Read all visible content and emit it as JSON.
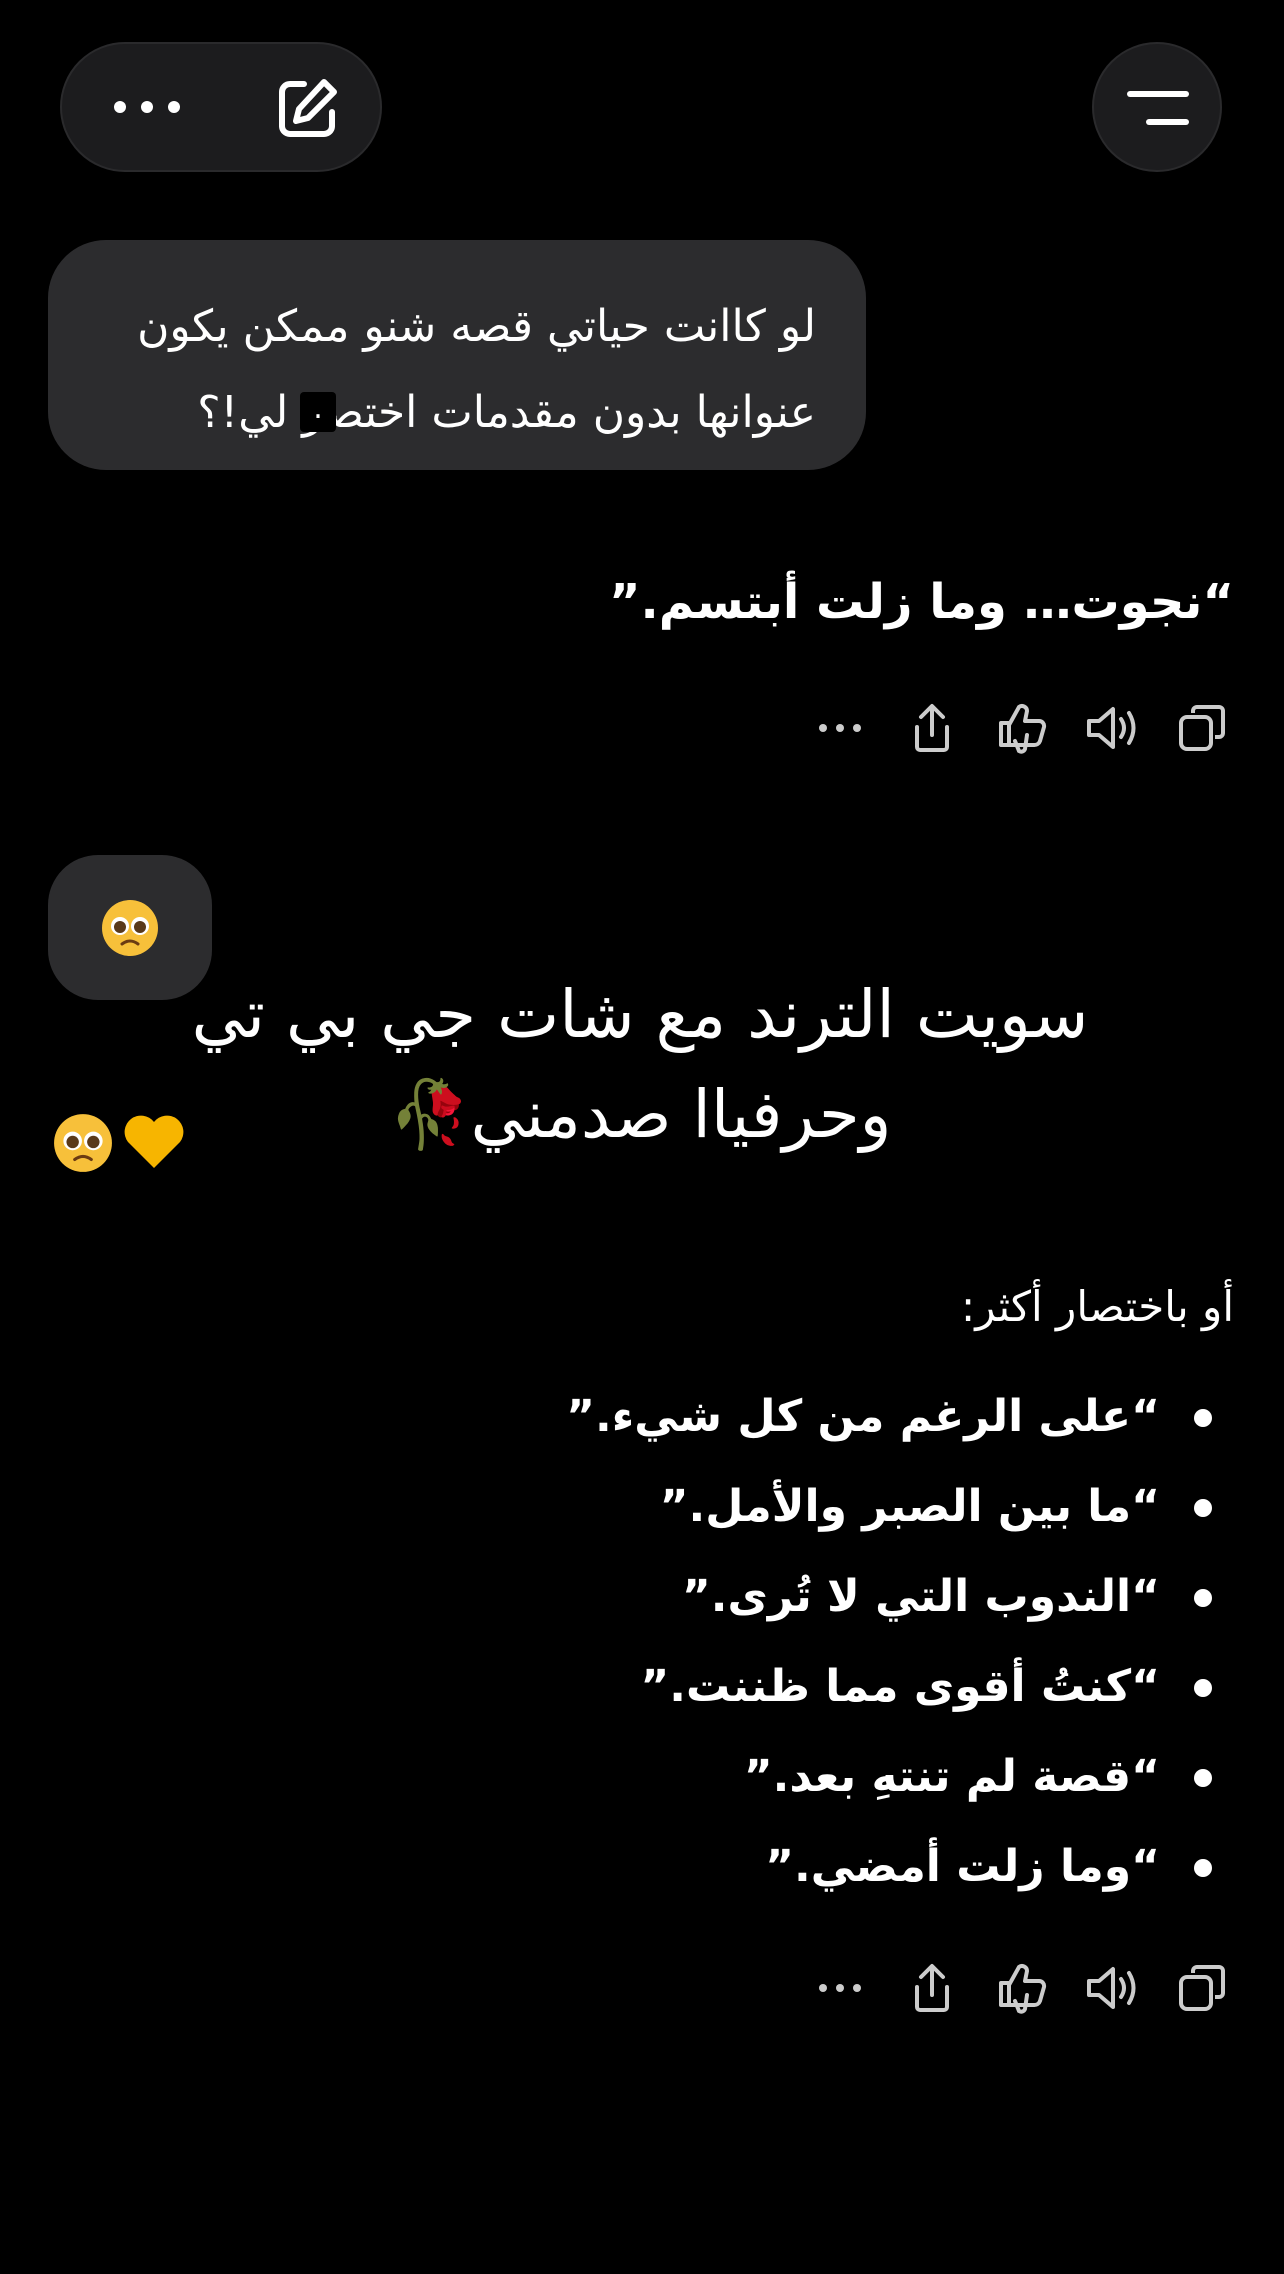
{
  "top_bar": {
    "more_icon": "more-horizontal-icon",
    "compose_icon": "compose-edit-icon",
    "menu_icon": "menu-lines-icon"
  },
  "user_message": {
    "line1": "لو كاانت حياتي قصه شنو ممكن يكون",
    "line2": "عنوانها بدون مقدمات اختصر لي!؟",
    "cursor_glyph": "."
  },
  "assistant_reply": {
    "text": "“نجوت… وما زلت أبتسم.”"
  },
  "action_row_icons": [
    "copy-icon",
    "speaker-icon",
    "thumbs-icon",
    "share-icon",
    "more-icon"
  ],
  "emoji_message": {
    "emoji": "🥺"
  },
  "overlay": {
    "line1": "سويت الترند مع شات جي بي تي",
    "line2": "وحرفياا صدمني🥀"
  },
  "hearts": {
    "emoji": "🥺💛"
  },
  "alternatives": {
    "heading": "أو باختصار أكثر:",
    "items": [
      "“على الرغم من كل شيء.”",
      "“ما بين الصبر والأمل.”",
      "“الندوب التي لا تُرى.”",
      "“كنتُ أقوى مما ظننت.”",
      "“قصة لم تنتهِ بعد.”",
      "“وما زلت أمضي.”"
    ]
  },
  "colors": {
    "background": "#000000",
    "bubble": "#2c2c2e",
    "pill": "#1c1c1e",
    "text": "#ffffff"
  }
}
